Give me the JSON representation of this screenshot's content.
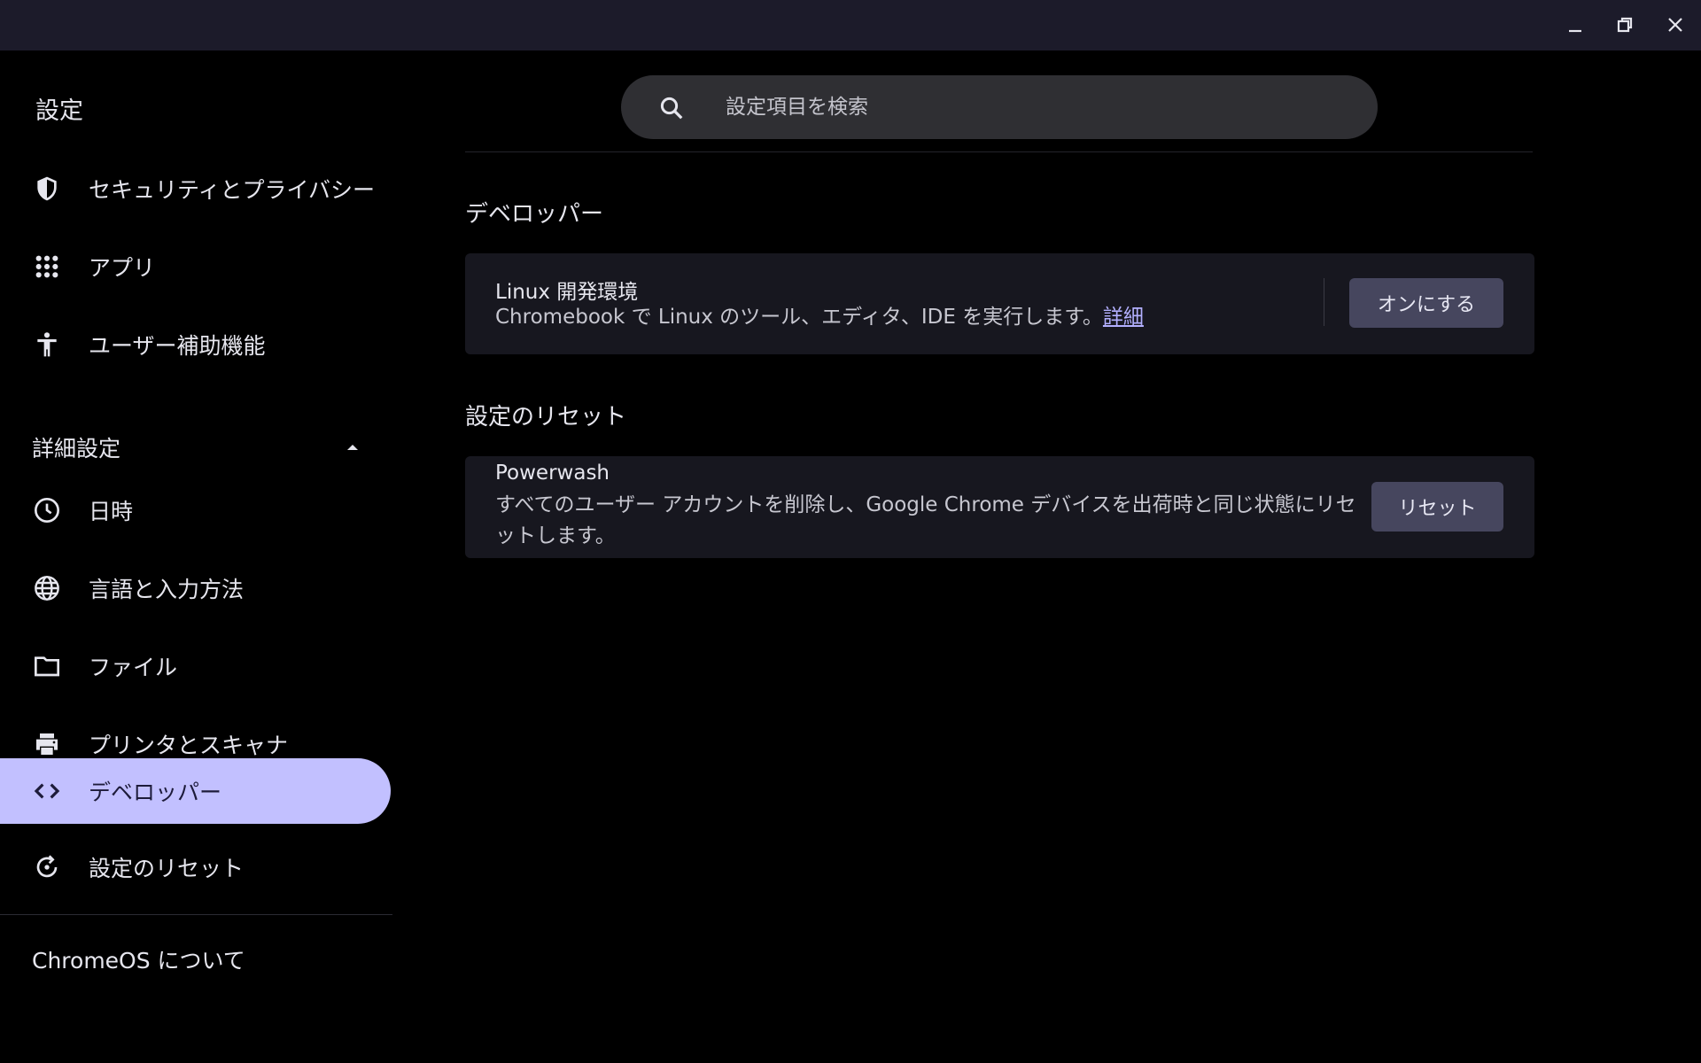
{
  "window": {
    "minimize_icon": "minimize-icon",
    "maximize_icon": "restore-icon",
    "close_icon": "close-icon"
  },
  "sidebar": {
    "title": "設定",
    "items_top": [
      {
        "label": "セキュリティとプライバシー",
        "icon": "shield-icon"
      },
      {
        "label": "アプリ",
        "icon": "apps-grid-icon"
      },
      {
        "label": "ユーザー補助機能",
        "icon": "accessibility-icon"
      }
    ],
    "advanced": {
      "label": "詳細設定",
      "expanded": true
    },
    "items_advanced": [
      {
        "label": "日時",
        "icon": "clock-icon"
      },
      {
        "label": "言語と入力方法",
        "icon": "globe-icon"
      },
      {
        "label": "ファイル",
        "icon": "folder-icon"
      },
      {
        "label": "プリンタとスキャナ",
        "icon": "printer-icon"
      },
      {
        "label": "デベロッパー",
        "icon": "code-icon",
        "selected": true
      },
      {
        "label": "設定のリセット",
        "icon": "reset-icon"
      }
    ],
    "about": "ChromeOS について",
    "selected_color": "#c2c0ff"
  },
  "search": {
    "placeholder": "設定項目を検索",
    "value": ""
  },
  "developer": {
    "section_title": "デベロッパー",
    "linux": {
      "title": "Linux 開発環境",
      "description": "Chromebook で Linux のツール、エディタ、IDE を実行します。",
      "link": "詳細",
      "button": "オンにする"
    }
  },
  "reset": {
    "section_title": "設定のリセット",
    "powerwash": {
      "title": "Powerwash",
      "description": "すべてのユーザー アカウントを削除し、Google Chrome デバイスを出荷時と同じ状態にリセットします。",
      "button": "リセット"
    }
  }
}
